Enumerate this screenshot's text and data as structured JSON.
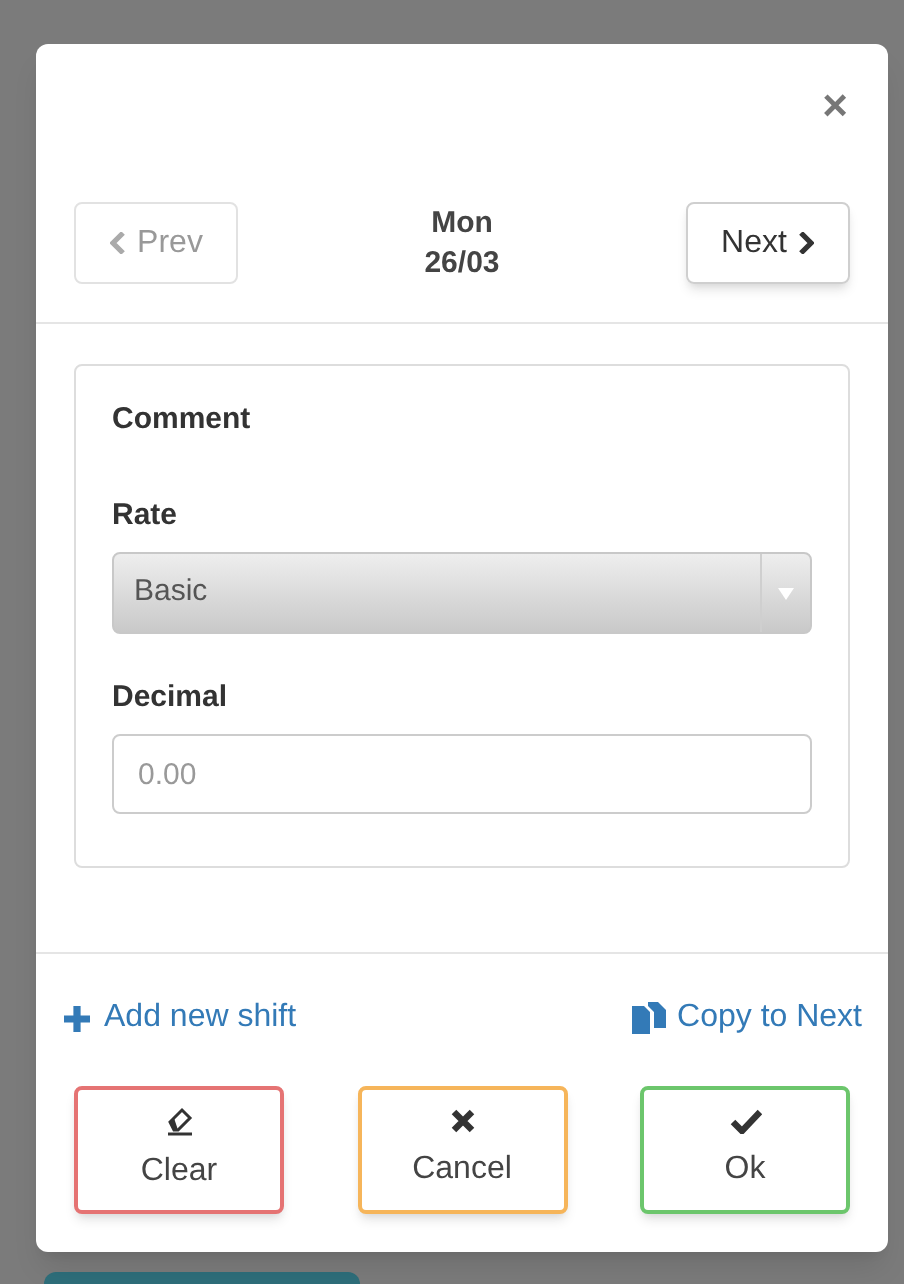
{
  "dialog": {
    "close": "×",
    "nav": {
      "prev": {
        "label": "Prev",
        "disabled": true
      },
      "day": "Mon",
      "date": "26/03",
      "next": {
        "label": "Next",
        "disabled": false
      }
    },
    "form": {
      "comment_label": "Comment",
      "rate_label": "Rate",
      "rate_value": "Basic",
      "decimal_label": "Decimal",
      "decimal_placeholder": "0.00"
    },
    "links": [
      {
        "label": "Add new shift",
        "kind": "add"
      },
      {
        "label": "Copy to Next",
        "kind": "copy"
      }
    ],
    "buttons": [
      {
        "label": "Clear",
        "kind": "clear"
      },
      {
        "label": "Cancel",
        "kind": "cancel"
      },
      {
        "label": "Ok",
        "kind": "ok"
      }
    ]
  }
}
